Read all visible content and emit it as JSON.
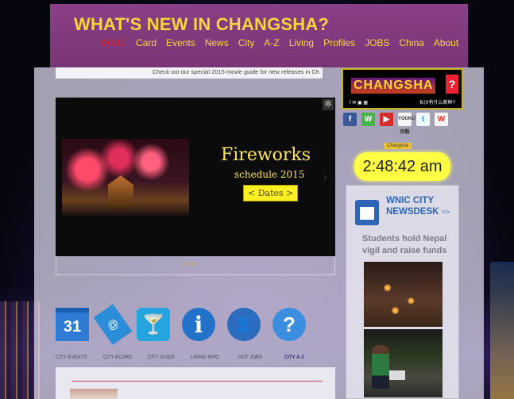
{
  "header": {
    "site_title": "WHAT'S NEW IN CHANGSHA?",
    "nav": [
      "WNIC",
      "Card",
      "Events",
      "News",
      "City",
      "A-Z",
      "Living",
      "Profiles",
      "JOBS",
      "China",
      "About"
    ]
  },
  "ticker": {
    "text": "Check out our special 2015 movie guide for new releases in Ch"
  },
  "slider": {
    "title": "Fireworks",
    "subtitle": "schedule 2015",
    "button": "< Dates >",
    "dot_label": "● Info"
  },
  "logo": {
    "name": "CHANGSHA",
    "question_mark": "?",
    "tagline": "长沙有什么新鲜?",
    "sub_icons": "f ✉ ▣ ▦"
  },
  "social": {
    "facebook": "f",
    "wechat": "W",
    "youtube": "▶",
    "youku": "YOUKU 优酷",
    "twitter": "t",
    "weibo": "W"
  },
  "clock": {
    "city": "Changsha",
    "time": "2:48:42 am"
  },
  "newsdesk": {
    "title_line1": "WNIC CITY",
    "title_line2": "NEWSDESK",
    "more": ">>",
    "headline": "Students hold Nepal vigil and raise funds"
  },
  "icons": [
    {
      "symbol": "31",
      "label": "CITY EVENTS"
    },
    {
      "symbol": "@",
      "label": "CITY ECARD"
    },
    {
      "symbol": "🍸",
      "label": "CITY GUIDE"
    },
    {
      "symbol": "i",
      "label": "LIVING INFO"
    },
    {
      "symbol": "👤",
      "label": "HOT JOBS"
    },
    {
      "symbol": "?",
      "label": "CITY A-Z"
    }
  ],
  "colors": {
    "header_bg": "#8a3f86",
    "title_yellow": "#f5d63a",
    "nav_active": "#e02020",
    "clock_bg": "#ffff44",
    "newsdesk_blue": "#2b66b3"
  }
}
